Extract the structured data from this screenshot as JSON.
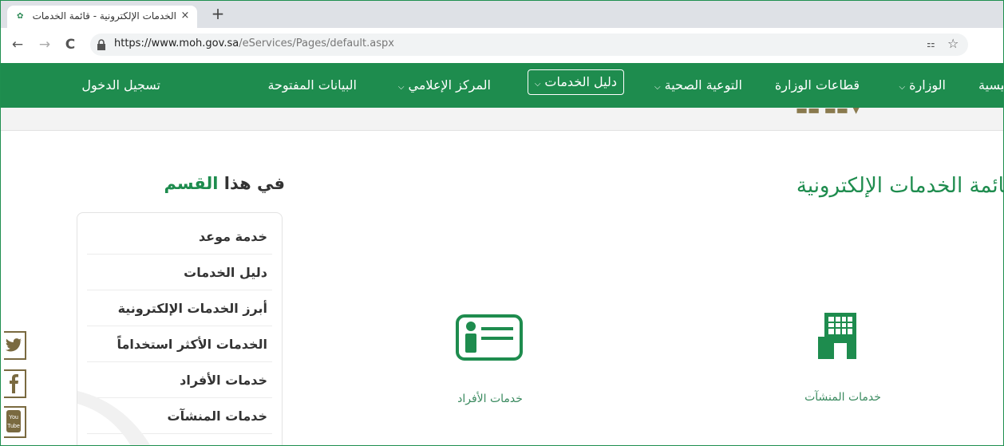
{
  "browser": {
    "tab_title": "الخدمات الإلكترونية - قائمة الخدمات",
    "tab_close": "×",
    "new_tab": "+",
    "url_host": "https://www.moh.gov.sa",
    "url_path": "/eServices/Pages/default.aspx",
    "back": "←",
    "forward": "→",
    "reload": "C",
    "star": "☆",
    "translate": "⚏"
  },
  "nav": {
    "items": [
      {
        "label": "ئيسية"
      },
      {
        "label": "الوزارة",
        "chevron": "⌵"
      },
      {
        "label": "قطاعات الوزارة"
      },
      {
        "label": "التوعية الصحية",
        "chevron": "⌵"
      },
      {
        "label": "دليل الخدمات",
        "chevron": "⌵",
        "active": true
      },
      {
        "label": "المركز الإعلامي",
        "chevron": "⌵"
      },
      {
        "label": "البيانات المفتوحة"
      },
      {
        "label": "تسجيل الدخول"
      }
    ]
  },
  "main": {
    "heading": "قائمة الخدمات الإلكترونية",
    "section_title_a": "في هذا",
    "section_title_b": "القسم",
    "menu": [
      "خدمة موعد",
      "دليل الخدمات",
      "أبرز الخدمات الإلكترونية",
      "الخدمات الأكثر استخداماً",
      "خدمات الأفراد",
      "خدمات المنشآت"
    ],
    "cards": [
      {
        "label": "خدمات الأفراد",
        "icon": "id-card-icon"
      },
      {
        "label": "خدمات المنشآت",
        "icon": "building-icon"
      }
    ]
  },
  "social": [
    "twitter-icon",
    "facebook-icon",
    "youtube-icon"
  ],
  "colors": {
    "brand": "#1e8c4e",
    "accent": "#7a6a40"
  }
}
